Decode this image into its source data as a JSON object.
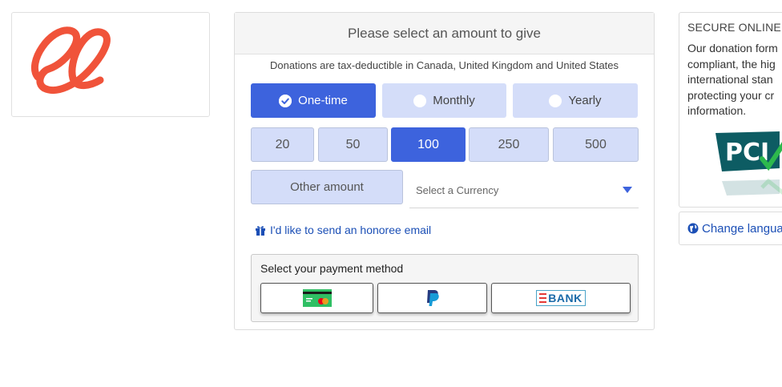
{
  "brand": {
    "logo_color": "#f0533a"
  },
  "header": {
    "title": "Please select an amount to give"
  },
  "tax_note": "Donations are tax-deductible in Canada, United Kingdom and United States",
  "frequency": {
    "options": [
      {
        "label": "One-time",
        "selected": true
      },
      {
        "label": "Monthly",
        "selected": false
      },
      {
        "label": "Yearly",
        "selected": false
      }
    ]
  },
  "amounts": {
    "options": [
      "20",
      "50",
      "100",
      "250",
      "500"
    ],
    "selected": "100",
    "other_label": "Other amount"
  },
  "currency": {
    "placeholder": "Select a Currency"
  },
  "honoree": {
    "label": "I'd like to send an honoree email"
  },
  "payment": {
    "title": "Select your payment method",
    "methods": [
      {
        "name": "card",
        "icon": "credit-card-icon"
      },
      {
        "name": "paypal",
        "icon": "paypal-icon"
      },
      {
        "name": "bank",
        "label": "BANK",
        "icon": "bank-icon"
      }
    ]
  },
  "secure": {
    "title": "SECURE ONLINE",
    "lines": [
      "Our donation form",
      "compliant, the hig",
      "international stan",
      "protecting your cr",
      "information."
    ],
    "badge": "PCI"
  },
  "language": {
    "label": "Change langua"
  },
  "colors": {
    "accent": "#3d63dd",
    "light_button": "#d4ddf9",
    "link": "#1b4fb6"
  }
}
